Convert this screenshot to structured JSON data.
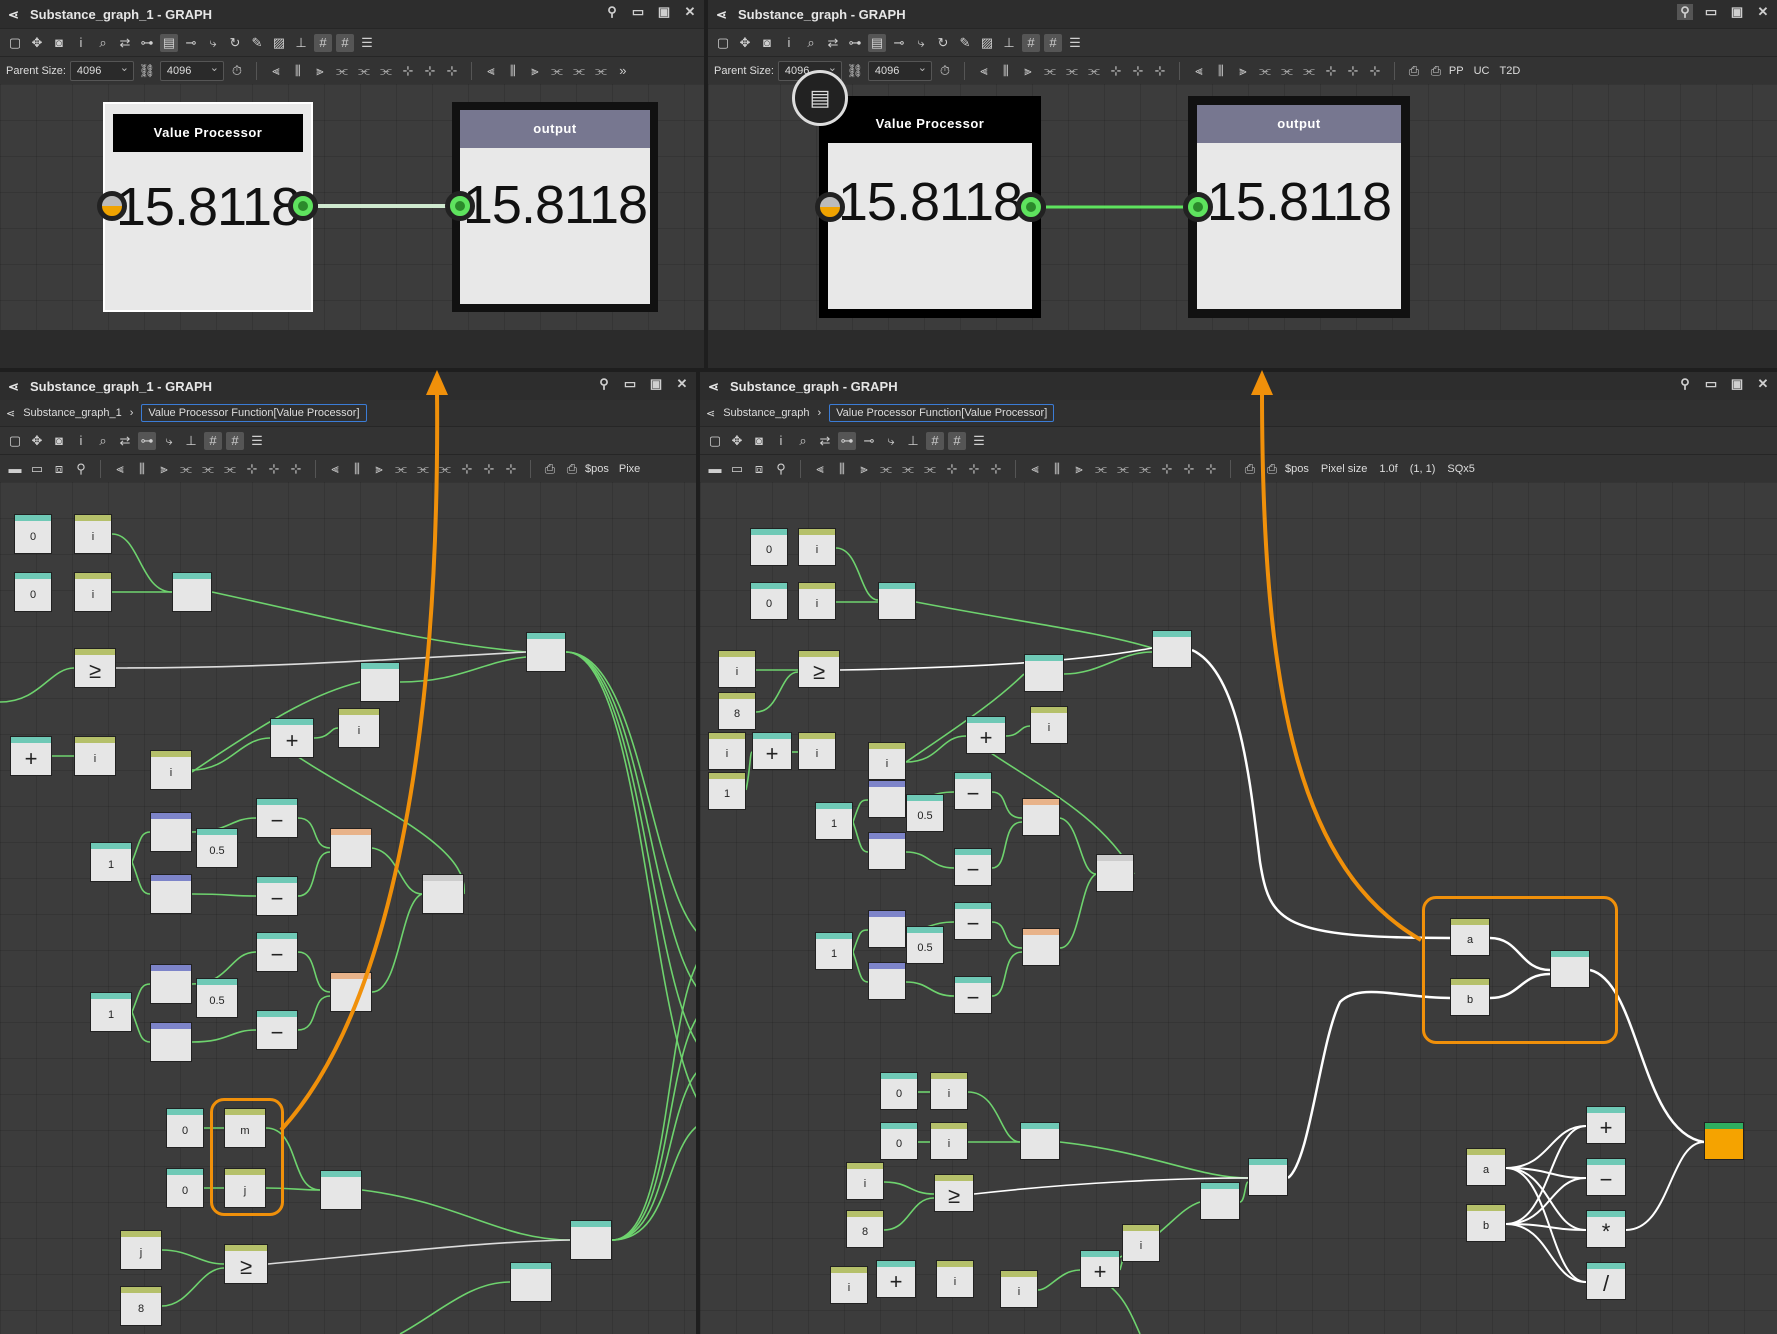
{
  "panes": {
    "top_left": {
      "title": "Substance_graph_1 - GRAPH",
      "parent_size_label": "Parent Size:",
      "parent_size_a": "4096",
      "parent_size_b": "4096"
    },
    "top_right": {
      "title": "Substance_graph - GRAPH",
      "parent_size_label": "Parent Size:",
      "parent_size_a": "4096",
      "parent_size_b": "4096",
      "extra": [
        "PP",
        "UC",
        "T2D"
      ]
    },
    "bottom_left": {
      "title": "Substance_graph_1 - GRAPH",
      "crumb_root": "Substance_graph_1",
      "crumb_active": "Value Processor Function[Value Processor]",
      "status": [
        "$pos",
        "Pixe"
      ]
    },
    "bottom_right": {
      "title": "Substance_graph - GRAPH",
      "crumb_root": "Substance_graph",
      "crumb_active": "Value Processor Function[Value Processor]",
      "status": [
        "$pos",
        "Pixel size",
        "1.0f",
        "(1, 1)",
        "SQx5"
      ]
    }
  },
  "big_nodes": {
    "value_processor_label": "Value Processor",
    "output_label": "output",
    "value": "15.8118"
  },
  "left_nodes": {
    "zero": "0",
    "i": "i",
    "ge": "≥",
    "plus": "+",
    "minus": "−",
    "mult": "*",
    "div": "/",
    "half": "0.5",
    "one": "1",
    "eight": "8",
    "m": "m",
    "j": "j"
  },
  "right_nodes": {
    "a": "a",
    "b": "b"
  },
  "colors": {
    "accent_orange": "#f0900a",
    "wire_green": "#6ed36e",
    "node_header_teal": "#6fc9b6",
    "node_header_olive": "#b5c06a",
    "node_header_blue": "#7d84c9",
    "node_header_peach": "#e8b38a"
  }
}
